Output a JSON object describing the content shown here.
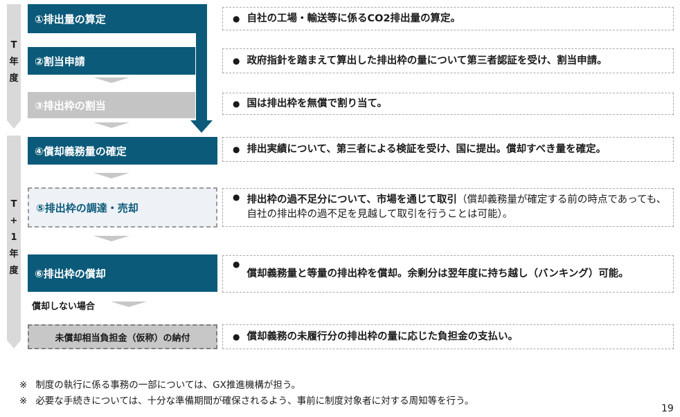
{
  "year_labels": {
    "t": [
      "T",
      "年",
      "度"
    ],
    "t1": [
      "T",
      "+",
      "1",
      "年",
      "度"
    ]
  },
  "steps": [
    {
      "label": "①排出量の算定"
    },
    {
      "label": "②割当申請"
    },
    {
      "label": "③排出枠の割当"
    },
    {
      "label": "④償却義務量の確定"
    },
    {
      "label": "⑤排出枠の調達・売却"
    },
    {
      "label": "⑥排出枠の償却"
    },
    {
      "label": "未償却相当負担金（仮称）の納付"
    }
  ],
  "skip_label": "償却しない場合",
  "bullet": "●",
  "descriptions": [
    {
      "bold": "自社の工場・輸送等に係るCO2排出量の算定。",
      "normal": ""
    },
    {
      "bold": "政府指針を踏まえて算出した排出枠の量について第三者認証を受け、割当申請。",
      "normal": ""
    },
    {
      "bold": "国は排出枠を無償で割り当て。",
      "normal": ""
    },
    {
      "bold": "排出実績について、第三者による検証を受け、国に提出。償却すべき量を確定。",
      "normal": ""
    },
    {
      "bold": "排出枠の過不足分について、市場を通じて取引",
      "normal": "（償却義務量が確定する前の時点であっても、自社の排出枠の過不足を見越して取引を行うことは可能）。"
    },
    {
      "bold": "償却義務量と等量の排出枠を償却。余剰分は翌年度に持ち越し（バンキング）可能。",
      "normal": ""
    },
    {
      "bold": "償却義務の未履行分の排出枠の量に応じた負担金の支払い。",
      "normal": ""
    }
  ],
  "notes": [
    {
      "mark": "※",
      "text": "制度の執行に係る事務の一部については、GX推進機構が担う。"
    },
    {
      "mark": "※",
      "text": "必要な手続きについては、十分な準備期間が確保されるよう、事前に制度対象者に対する周知等を行う。"
    }
  ],
  "page_number": "19",
  "colors": {
    "step_blue": "#0b5a7a",
    "step_gray": "#c4c4c4",
    "year_bar": "#d9d9d9"
  }
}
